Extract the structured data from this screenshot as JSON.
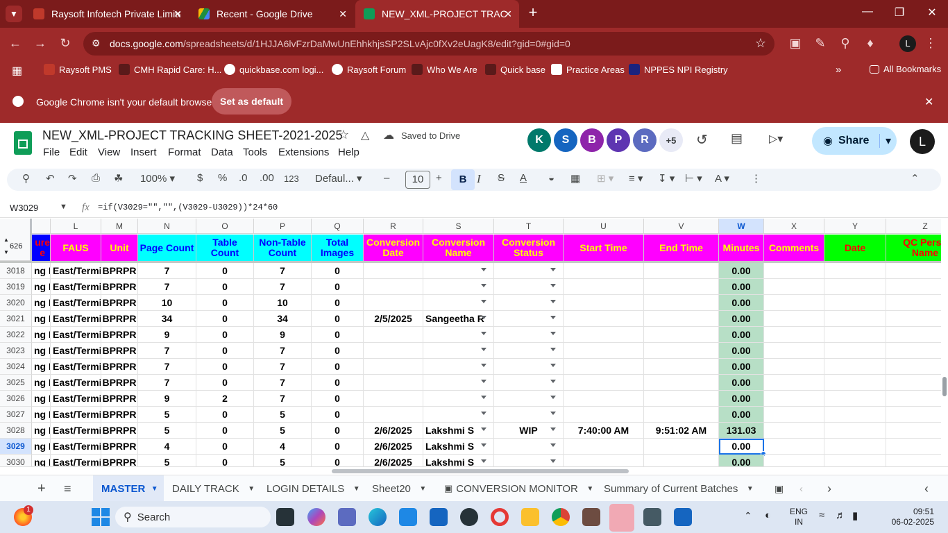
{
  "browser": {
    "tabs": [
      {
        "title": "Raysoft Infotech Private Limited",
        "color": "#c0392b"
      },
      {
        "title": "Recent - Google Drive",
        "color": "#1e8e3e"
      },
      {
        "title": "NEW_XML-PROJECT TRACKING",
        "color": "#0f9d58"
      }
    ],
    "url_host": "docs.google.com",
    "url_path": "/spreadsheets/d/1HJJA6lvFzrDaMwUnEhhkhjsSP2SLvAjc0fXv2eUagK8/edit?gid=0#gid=0",
    "profile_initial": "L",
    "bookmarks": [
      "Raysoft PMS",
      "CMH Rapid Care: H...",
      "quickbase.com logi...",
      "Raysoft Forum",
      "Who We Are",
      "Quick base",
      "Practice Areas",
      "NPPES NPI Registry"
    ],
    "all_bookmarks": "All Bookmarks",
    "infobar_text": "Google Chrome isn't your default browser",
    "infobar_button": "Set as default"
  },
  "doc": {
    "title": "NEW_XML-PROJECT TRACKING SHEET-2021-2025",
    "saved_status": "Saved to Drive",
    "menu": [
      "File",
      "Edit",
      "View",
      "Insert",
      "Format",
      "Data",
      "Tools",
      "Extensions",
      "Help"
    ],
    "collaborators": [
      {
        "initial": "K",
        "color": "#00796b"
      },
      {
        "initial": "S",
        "color": "#1565c0"
      },
      {
        "initial": "B",
        "color": "#8e24aa"
      },
      {
        "initial": "P",
        "color": "#5e35b1"
      },
      {
        "initial": "R",
        "color": "#5c6bc0"
      }
    ],
    "more_collaborators": "+5",
    "share_label": "Share",
    "user_initial": "L"
  },
  "toolbar": {
    "zoom": "100%",
    "currency": "$",
    "percent": "%",
    "dec_less": ".0",
    "dec_more": ".00",
    "number_format": "123",
    "font": "Defaul...",
    "font_size": "10"
  },
  "formula_bar": {
    "name_box": "W3029",
    "fx": "fx",
    "formula": "=if(V3029=\"\",\"\",(V3029-U3029))*24*60"
  },
  "sheet": {
    "corner_label": "626",
    "columns": [
      {
        "letter": "",
        "header": "ure\ne",
        "color": "#ff0000",
        "bg": "#0000ff"
      },
      {
        "letter": "L",
        "header": "FAUS",
        "color": "#ffff00",
        "bg": "#ff00ff"
      },
      {
        "letter": "M",
        "header": "Unit",
        "color": "#ffff00",
        "bg": "#ff00ff"
      },
      {
        "letter": "N",
        "header": "Page Count",
        "color": "#0000ff",
        "bg": "#00ffff"
      },
      {
        "letter": "O",
        "header": "Table\nCount",
        "color": "#0000ff",
        "bg": "#00ffff"
      },
      {
        "letter": "P",
        "header": "Non-Table\nCount",
        "color": "#0000ff",
        "bg": "#00ffff"
      },
      {
        "letter": "Q",
        "header": "Total\nImages",
        "color": "#0000ff",
        "bg": "#00ffff"
      },
      {
        "letter": "R",
        "header": "Conversion\nDate",
        "color": "#ffff00",
        "bg": "#ff00ff"
      },
      {
        "letter": "S",
        "header": "Conversion\nName",
        "color": "#ffff00",
        "bg": "#ff00ff"
      },
      {
        "letter": "T",
        "header": "Conversion\nStatus",
        "color": "#ffff00",
        "bg": "#ff00ff"
      },
      {
        "letter": "U",
        "header": "Start Time",
        "color": "#ffff00",
        "bg": "#ff00ff"
      },
      {
        "letter": "V",
        "header": "End Time",
        "color": "#ffff00",
        "bg": "#ff00ff"
      },
      {
        "letter": "W",
        "header": "Minutes",
        "color": "#ffff00",
        "bg": "#ff00ff"
      },
      {
        "letter": "X",
        "header": "Comments",
        "color": "#ffff00",
        "bg": "#ff00ff"
      },
      {
        "letter": "Y",
        "header": "Date",
        "color": "#ff0000",
        "bg": "#00ff00"
      },
      {
        "letter": "Z",
        "header": "QC Perso\nName",
        "color": "#ff0000",
        "bg": "#00ff00"
      }
    ],
    "rows": [
      {
        "num": "3018",
        "cells": [
          "ng Pr",
          "East/Termir",
          "BPRPR",
          "7",
          "0",
          "7",
          "0",
          "",
          "",
          "",
          "",
          "",
          "0.00",
          "",
          "",
          ""
        ]
      },
      {
        "num": "3019",
        "cells": [
          "ng Pr",
          "East/Termir",
          "BPRPR",
          "7",
          "0",
          "7",
          "0",
          "",
          "",
          "",
          "",
          "",
          "0.00",
          "",
          "",
          ""
        ]
      },
      {
        "num": "3020",
        "cells": [
          "ng Pr",
          "East/Termir",
          "BPRPR",
          "10",
          "0",
          "10",
          "0",
          "",
          "",
          "",
          "",
          "",
          "0.00",
          "",
          "",
          ""
        ]
      },
      {
        "num": "3021",
        "cells": [
          "ng Pr",
          "East/Termir",
          "BPRPR",
          "34",
          "0",
          "34",
          "0",
          "2/5/2025",
          "Sangeetha R",
          "",
          "",
          "",
          "0.00",
          "",
          "",
          ""
        ]
      },
      {
        "num": "3022",
        "cells": [
          "ng Pr",
          "East/Termir",
          "BPRPR",
          "9",
          "0",
          "9",
          "0",
          "",
          "",
          "",
          "",
          "",
          "0.00",
          "",
          "",
          ""
        ]
      },
      {
        "num": "3023",
        "cells": [
          "ng Pr",
          "East/Termir",
          "BPRPR",
          "7",
          "0",
          "7",
          "0",
          "",
          "",
          "",
          "",
          "",
          "0.00",
          "",
          "",
          ""
        ]
      },
      {
        "num": "3024",
        "cells": [
          "ng Pr",
          "East/Termir",
          "BPRPR",
          "7",
          "0",
          "7",
          "0",
          "",
          "",
          "",
          "",
          "",
          "0.00",
          "",
          "",
          ""
        ]
      },
      {
        "num": "3025",
        "cells": [
          "ng Pr",
          "East/Termir",
          "BPRPR",
          "7",
          "0",
          "7",
          "0",
          "",
          "",
          "",
          "",
          "",
          "0.00",
          "",
          "",
          ""
        ]
      },
      {
        "num": "3026",
        "cells": [
          "ng Pr",
          "East/Termir",
          "BPRPR",
          "9",
          "2",
          "7",
          "0",
          "",
          "",
          "",
          "",
          "",
          "0.00",
          "",
          "",
          ""
        ]
      },
      {
        "num": "3027",
        "cells": [
          "ng Pr",
          "East/Termir",
          "BPRPR",
          "5",
          "0",
          "5",
          "0",
          "",
          "",
          "",
          "",
          "",
          "0.00",
          "",
          "",
          ""
        ]
      },
      {
        "num": "3028",
        "cells": [
          "ng Pr",
          "East/Termir",
          "BPRPR",
          "5",
          "0",
          "5",
          "0",
          "2/6/2025",
          "Lakshmi S",
          "WIP",
          "7:40:00 AM",
          "9:51:02 AM",
          "131.03",
          "",
          "",
          ""
        ]
      },
      {
        "num": "3029",
        "cells": [
          "ng Pr",
          "East/Termir",
          "BPRPR",
          "4",
          "0",
          "4",
          "0",
          "2/6/2025",
          "Lakshmi S",
          "",
          "",
          "",
          "0.00",
          "",
          "",
          ""
        ]
      },
      {
        "num": "3030",
        "cells": [
          "ng Pr",
          "East/Termir",
          "BPRPR",
          "5",
          "0",
          "5",
          "0",
          "2/6/2025",
          "Lakshmi S",
          "",
          "",
          "",
          "0.00",
          "",
          "",
          ""
        ]
      }
    ],
    "selected_row": "3029",
    "selected_col": "W",
    "minutes_bg": "#b7dfc6"
  },
  "sheet_tabs": [
    "MASTER",
    "DAILY TRACK",
    "LOGIN DETAILS",
    "Sheet20",
    "CONVERSION MONITOR",
    "Summary of Current Batches"
  ],
  "taskbar": {
    "search": "Search",
    "lang_top": "ENG",
    "lang_bottom": "IN",
    "time": "09:51",
    "date": "06-02-2025",
    "notification_badge": "1"
  }
}
